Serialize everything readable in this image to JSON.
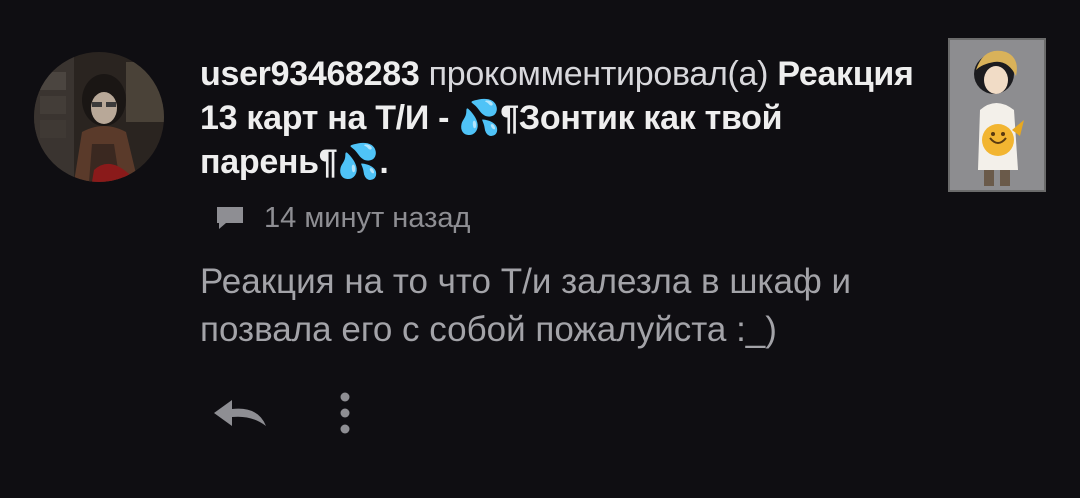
{
  "notification": {
    "username": "user93468283",
    "action": "прокомментировал(а)",
    "story_title": "Реакция 13 карт на Т/И - 💦¶Зонтик как твой парень¶💦.",
    "time_ago": "14 минут назад",
    "comment_text": "Реакция на то что Т/и залезла в шкаф и позвала его с собой пожалуйста :_)"
  },
  "icons": {
    "comment": "comment-bubble-icon",
    "reply": "reply-arrow-icon",
    "more": "more-vertical-icon"
  },
  "colors": {
    "background": "#0f0e12",
    "title_text": "#eeeeee",
    "meta_text": "#8e8e93",
    "body_text": "#a3a3a8"
  }
}
